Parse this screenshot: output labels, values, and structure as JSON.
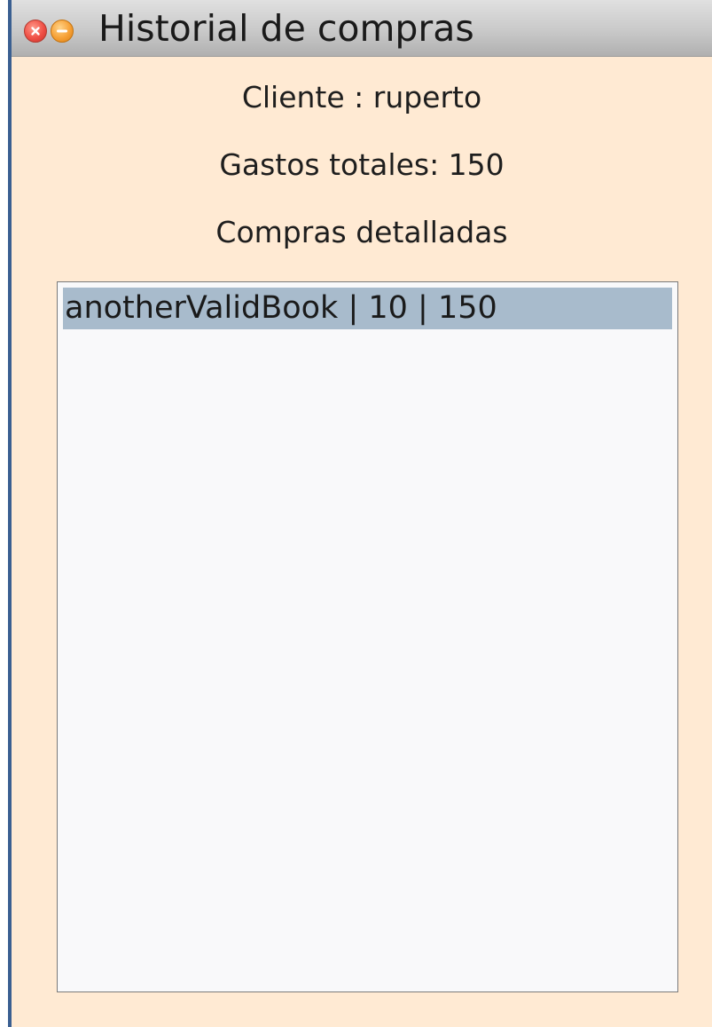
{
  "window": {
    "title": "Historial de compras"
  },
  "client": {
    "label": "Cliente : ruperto"
  },
  "totals": {
    "label": "Gastos totales: 150"
  },
  "details": {
    "label": "Compras detalladas"
  },
  "purchases": {
    "items": [
      {
        "text": "anotherValidBook | 10 | 150",
        "selected": true
      }
    ]
  },
  "colors": {
    "background": "#ffead3",
    "selection": "#a8bbcc",
    "close_button": "#ef4f45",
    "minimize_button": "#f6a035",
    "window_border": "#3a5f91"
  },
  "icons": {
    "close": "close-icon",
    "minimize": "minimize-icon"
  }
}
